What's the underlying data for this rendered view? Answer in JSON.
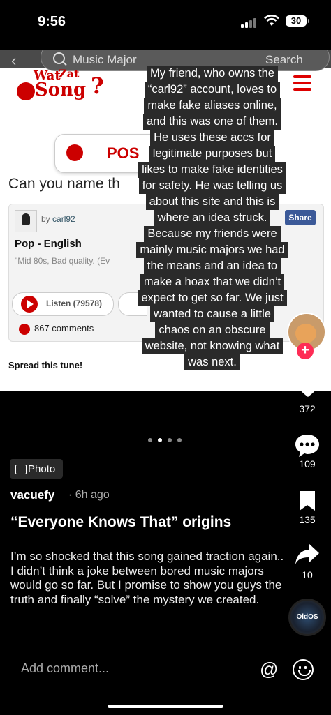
{
  "status": {
    "time": "9:56",
    "battery": "30"
  },
  "web": {
    "search_placeholder": "Music Major",
    "search_button": "Search",
    "logo": {
      "wat": "Wat",
      "zat": "Zat",
      "song": "Song",
      "q": "?"
    },
    "post_button": "POS",
    "question": "Can you name th",
    "card": {
      "by_prefix": "by",
      "by_user": "carl92",
      "share": "Share",
      "genre": "Pop - English",
      "description": "\"Mid 80s, Bad quality. (Ev",
      "listen_label": "Listen (79578)",
      "comments": "867 comments"
    },
    "spread": "Spread this tune!"
  },
  "overlay_lines": [
    "My friend, who owns the",
    "“carl92” account, loves to",
    "make fake aliases online,",
    "and this was one of them.",
    "He uses these accs for",
    "legitimate purposes but",
    "likes to make fake identities",
    "for safety. He was telling us",
    "about this site and this is",
    "where an idea struck.",
    "Because my friends were",
    "mainly music majors we had",
    "the means and an idea to",
    "make a hoax that we didn’t",
    "expect to get so far. We just",
    "wanted to cause a little",
    "chaos on an obscure",
    "website, not knowing what",
    "was next."
  ],
  "sidebar": {
    "likes": "372",
    "comments": "109",
    "saves": "135",
    "shares": "10",
    "disc_label": "OldOS"
  },
  "post": {
    "badge": "Photo",
    "username": "vacuefy",
    "time_ago": "· 6h ago",
    "title": "“Everyone Knows That” origins",
    "body": "I’m so shocked that this song gained traction again.. I didn’t think a joke between bored music majors would go so far. But I promise to show you guys the truth and finally “solve” the mystery we created."
  },
  "comment_placeholder": "Add comment...",
  "colors": {
    "accent_red": "#fe2c55",
    "site_red": "#cc0000",
    "share_blue": "#3b5998"
  }
}
